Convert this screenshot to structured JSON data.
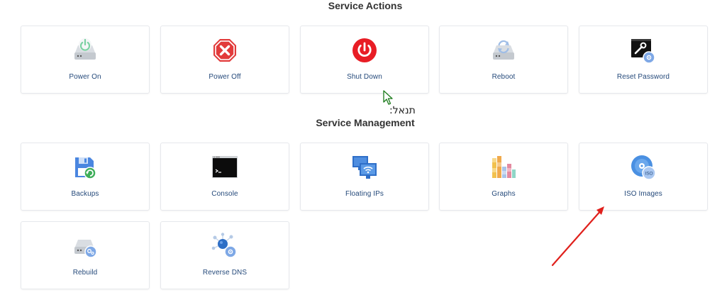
{
  "sections": {
    "actions": {
      "title": "Service Actions",
      "tiles": [
        {
          "label": "Power On",
          "icon": "power-on-icon"
        },
        {
          "label": "Power Off",
          "icon": "power-off-icon"
        },
        {
          "label": "Shut Down",
          "icon": "shut-down-icon"
        },
        {
          "label": "Reboot",
          "icon": "reboot-icon"
        },
        {
          "label": "Reset Password",
          "icon": "reset-password-icon"
        }
      ]
    },
    "management": {
      "title": "Service Management",
      "tiles": [
        {
          "label": "Backups",
          "icon": "backups-icon"
        },
        {
          "label": "Console",
          "icon": "console-icon"
        },
        {
          "label": "Floating IPs",
          "icon": "floating-ips-icon"
        },
        {
          "label": "Graphs",
          "icon": "graphs-icon"
        },
        {
          "label": "ISO Images",
          "icon": "iso-images-icon"
        },
        {
          "label": "Rebuild",
          "icon": "rebuild-icon"
        },
        {
          "label": "Reverse DNS",
          "icon": "reverse-dns-icon"
        }
      ]
    }
  },
  "overlay": {
    "hebrew_text": "תנאל:",
    "iso_badge": "ISO"
  },
  "colors": {
    "label": "#24497a",
    "annotation_arrow": "#e0201c",
    "power_off_red": "#e23b3b",
    "accent_blue": "#4a90e2"
  }
}
